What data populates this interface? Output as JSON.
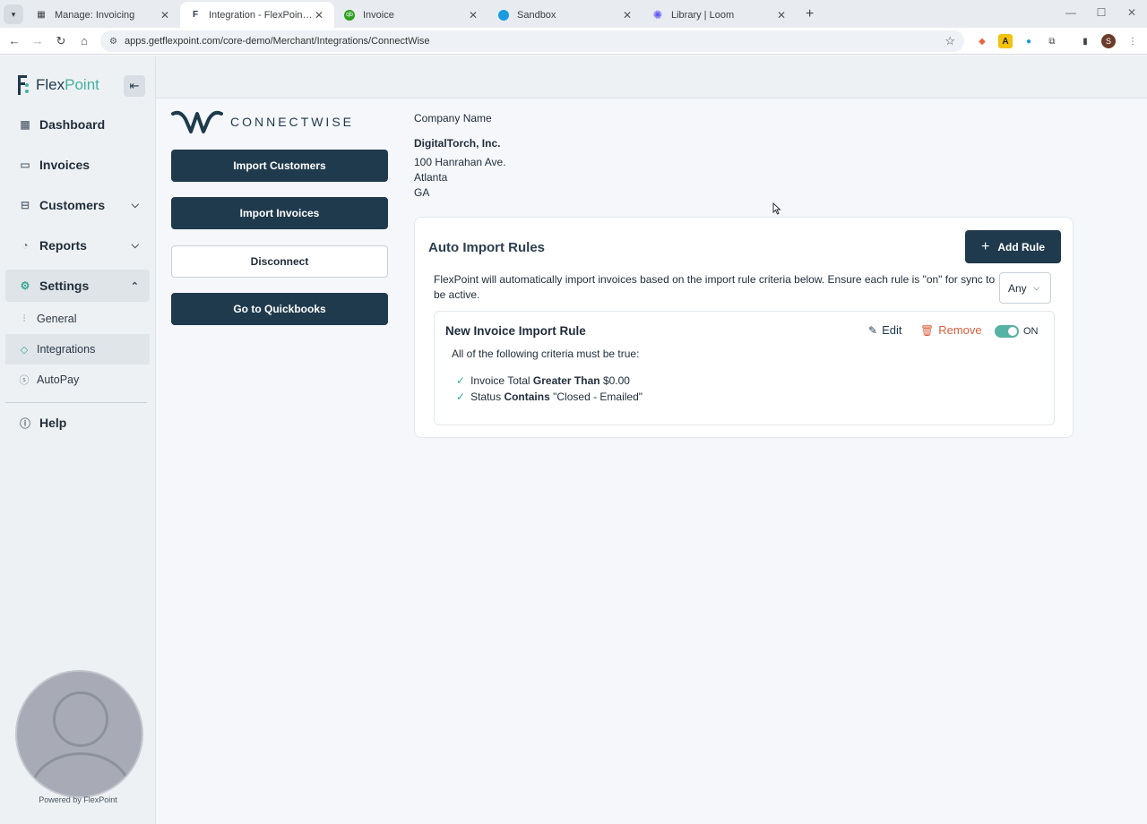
{
  "browser": {
    "tabs": [
      {
        "title": "Manage: Invoicing",
        "icon": "grid-icon"
      },
      {
        "title": "Integration - FlexPoint (Mercha",
        "icon": "flexpoint-favicon"
      },
      {
        "title": "Invoice",
        "icon": "quickbooks-favicon"
      },
      {
        "title": "Sandbox",
        "icon": "sandbox-favicon"
      },
      {
        "title": "Library | Loom",
        "icon": "loom-favicon"
      }
    ],
    "url": "apps.getflexpoint.com/core-demo/Merchant/Integrations/ConnectWise",
    "profile_initial": "S"
  },
  "sidebar": {
    "brand_part1": "Flex",
    "brand_part2": "Point",
    "nav": [
      {
        "label": "Dashboard"
      },
      {
        "label": "Invoices"
      },
      {
        "label": "Customers"
      },
      {
        "label": "Reports"
      },
      {
        "label": "Settings"
      }
    ],
    "settings_sub": [
      {
        "label": "General"
      },
      {
        "label": "Integrations"
      },
      {
        "label": "AutoPay"
      }
    ],
    "help_label": "Help",
    "powered_by": "Powered by FlexPoint"
  },
  "integration": {
    "logo_text": "CONNECTWISE",
    "buttons": {
      "import_customers": "Import Customers",
      "import_invoices": "Import Invoices",
      "disconnect": "Disconnect",
      "go_quickbooks": "Go to Quickbooks"
    }
  },
  "company": {
    "label": "Company Name",
    "name": "DigitalTorch, Inc.",
    "address_line": "100 Hanrahan Ave.",
    "city": "Atlanta",
    "state": "GA"
  },
  "rules": {
    "title": "Auto Import Rules",
    "add_label": "Add Rule",
    "description": "FlexPoint will automatically import invoices based on the import rule criteria below. Ensure each rule is \"on\" for sync to be active.",
    "match_select": "Any",
    "items": [
      {
        "name": "New Invoice Import Rule",
        "edit_label": "Edit",
        "remove_label": "Remove",
        "toggle_label": "ON",
        "enabled": true,
        "intro": "All of the following criteria must be true:",
        "criteria": [
          {
            "field": "Invoice Total",
            "op": "Greater Than",
            "value": "$0.00"
          },
          {
            "field": "Status",
            "op": "Contains",
            "value": "\"Closed - Emailed\""
          }
        ]
      }
    ]
  },
  "colors": {
    "primary": "#1f3a4d",
    "accent": "#40b2a0",
    "danger": "#d9603f"
  }
}
